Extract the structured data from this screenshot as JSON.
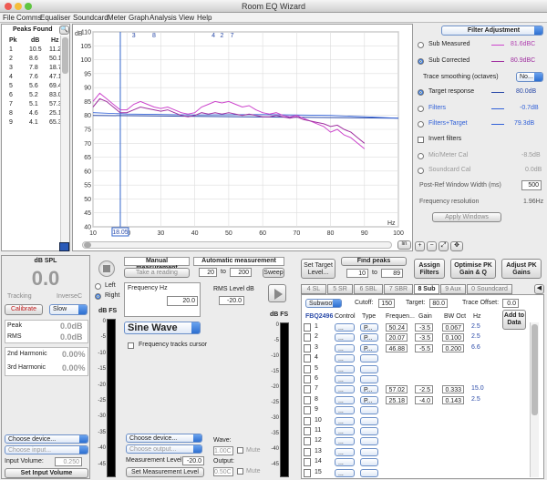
{
  "window_title": "Room EQ Wizard",
  "menu": [
    "File",
    "Comms",
    "Equaliser",
    "Soundcard",
    "Meter",
    "Graph",
    "Analysis",
    "View",
    "Help"
  ],
  "peaks": {
    "title": "Peaks Found",
    "headers": [
      "Pk",
      "dB",
      "Hz"
    ],
    "rows": [
      [
        "1",
        "10.5",
        "11.2"
      ],
      [
        "2",
        "8.6",
        "50.1"
      ],
      [
        "3",
        "7.8",
        "18.7"
      ],
      [
        "4",
        "7.6",
        "47.1"
      ],
      [
        "5",
        "5.6",
        "69.4"
      ],
      [
        "6",
        "5.2",
        "83.0"
      ],
      [
        "7",
        "5.1",
        "57.3"
      ],
      [
        "8",
        "4.6",
        "25.1"
      ],
      [
        "9",
        "4.1",
        "65.3"
      ]
    ]
  },
  "graph": {
    "y_unit": "dB",
    "x_unit": "Hz",
    "y_ticks": [
      "110",
      "105",
      "100",
      "95",
      "90",
      "85",
      "80",
      "75",
      "70",
      "65",
      "60",
      "55",
      "50",
      "45",
      "40"
    ],
    "x_ticks": [
      "10",
      "20",
      "30",
      "40",
      "50",
      "60",
      "70",
      "80",
      "90",
      "100"
    ],
    "peak_markers": [
      "3",
      "8",
      "4",
      "2",
      "7"
    ],
    "cursor_freq": "18.05"
  },
  "filter": {
    "title": "Filter Adjustment",
    "sub_measured": "Sub Measured",
    "sub_measured_val": "81.6dBC",
    "sub_corrected": "Sub Corrected",
    "sub_corrected_val": "80.9dBC",
    "smoothing_label": "Trace smoothing (octaves)",
    "smoothing_val": "No...",
    "target": "Target response",
    "target_val": "80.0dB",
    "filters": "Filters",
    "filters_val": "-0.7dB",
    "ft": "Filters+Target",
    "ft_val": "79.3dB",
    "invert": "Invert filters",
    "micmeter": "Mic/Meter Cal",
    "micmeter_val": "-8.5dB",
    "sccal": "Soundcard Cal",
    "sccal_val": "0.0dB",
    "pfr": "Post-Ref Window Width (ms)",
    "pfr_val": "500",
    "fres": "Frequency resolution",
    "fres_val": "1.96Hz",
    "apply": "Apply Windows"
  },
  "splmeter": {
    "title": "dB SPL",
    "value": "0.0",
    "tracking": "Tracking",
    "inverse": "InverseC",
    "calibrate": "Calibrate",
    "speed": "Slow",
    "peak": "Peak",
    "peak_val": "0.0dB",
    "rms": "RMS",
    "rms_val": "0.0dB",
    "h2": "2nd Harmonic",
    "h2_val": "0.00%",
    "h3": "3rd Harmonic",
    "h3_val": "0.00%",
    "device": "Choose device...",
    "input": "Choose input...",
    "input_vol_label": "Input Volume:",
    "input_vol": "0.250",
    "set_input": "Set Input Volume"
  },
  "measure": {
    "left": "Left",
    "right": "Right",
    "dbfs": "dB FS",
    "manual": "Manual measurement",
    "take": "Take a reading",
    "auto": "Automatic measurement",
    "from": "20",
    "to_lbl": "to",
    "to": "200",
    "sweep": "Sweep",
    "freq_label": "Frequency Hz",
    "freq_val": "20.0",
    "rms_level_label": "RMS Level dB",
    "rms_level": "-20.0",
    "wave": "Sine Wave",
    "track_cursor": "Frequency tracks cursor",
    "device": "Choose device...",
    "output": "Choose output...",
    "meas_level_label": "Measurement Level:",
    "meas_level": "-20.0",
    "wave_label": "Wave:",
    "wave_val": "1.00C",
    "mute": "Mute",
    "output_label": "Output:",
    "output_val": "0.50C",
    "mute2": "Mute",
    "set_level": "Set Measurement Level",
    "meter_ticks": [
      "0",
      "-5",
      "-10",
      "-15",
      "-20",
      "-25",
      "-30",
      "-35",
      "-40",
      "-45"
    ]
  },
  "eq": {
    "set_target": "Set Target Level...",
    "find_peaks": "Find peaks",
    "fp_from": "10",
    "fp_to_lbl": "to",
    "fp_to": "89",
    "assign": "Assign Filters",
    "optimise": "Optimise PK Gain & Q",
    "adjust": "Adjust PK Gains",
    "tabs": [
      "4 SL",
      "5 SR",
      "6 SBL",
      "7 SBR",
      "8 Sub",
      "9 Aux",
      "0 Soundcard"
    ],
    "channel": "Subwoofer",
    "cutoff_label": "Cutoff:",
    "cutoff": "150",
    "target_label": "Target:",
    "target": "80.0",
    "trace_offset_label": "Trace Offset:",
    "trace_offset": "0.0",
    "device": "FBQ2496",
    "headers": [
      "Control",
      "Type",
      "Frequen...",
      "Gain",
      "BW Oct",
      "Hz"
    ],
    "add": "Add to Data",
    "rows": [
      {
        "n": "1",
        "control": "...",
        "type": "P...",
        "freq": "50.24",
        "gain": "-3.5",
        "bw": "0.067",
        "hz": "2.5"
      },
      {
        "n": "2",
        "control": "...",
        "type": "P...",
        "freq": "20.07",
        "gain": "-3.5",
        "bw": "0.100",
        "hz": "2.5"
      },
      {
        "n": "3",
        "control": "...",
        "type": "P...",
        "freq": "46.88",
        "gain": "-5.5",
        "bw": "0.200",
        "hz": "6.6"
      },
      {
        "n": "4",
        "control": "...",
        "type": "",
        "freq": "",
        "gain": "",
        "bw": "",
        "hz": ""
      },
      {
        "n": "5",
        "control": "...",
        "type": "",
        "freq": "",
        "gain": "",
        "bw": "",
        "hz": ""
      },
      {
        "n": "6",
        "control": "...",
        "type": "",
        "freq": "",
        "gain": "",
        "bw": "",
        "hz": ""
      },
      {
        "n": "7",
        "control": "...",
        "type": "P...",
        "freq": "57.02",
        "gain": "-2.5",
        "bw": "0.333",
        "hz": "15.0"
      },
      {
        "n": "8",
        "control": "...",
        "type": "P...",
        "freq": "25.18",
        "gain": "-4.0",
        "bw": "0.143",
        "hz": "2.5"
      },
      {
        "n": "9",
        "control": "...",
        "type": "",
        "freq": "",
        "gain": "",
        "bw": "",
        "hz": ""
      },
      {
        "n": "10",
        "control": "...",
        "type": "",
        "freq": "",
        "gain": "",
        "bw": "",
        "hz": ""
      },
      {
        "n": "11",
        "control": "...",
        "type": "",
        "freq": "",
        "gain": "",
        "bw": "",
        "hz": ""
      },
      {
        "n": "12",
        "control": "...",
        "type": "",
        "freq": "",
        "gain": "",
        "bw": "",
        "hz": ""
      },
      {
        "n": "13",
        "control": "...",
        "type": "",
        "freq": "",
        "gain": "",
        "bw": "",
        "hz": ""
      },
      {
        "n": "14",
        "control": "...",
        "type": "",
        "freq": "",
        "gain": "",
        "bw": "",
        "hz": ""
      },
      {
        "n": "15",
        "control": "...",
        "type": "",
        "freq": "",
        "gain": "",
        "bw": "",
        "hz": ""
      }
    ]
  },
  "colors": {
    "measured": "#cc44cc",
    "corrected": "#a030a0",
    "target": "#2a4aa8",
    "filters": "#3060d8"
  }
}
